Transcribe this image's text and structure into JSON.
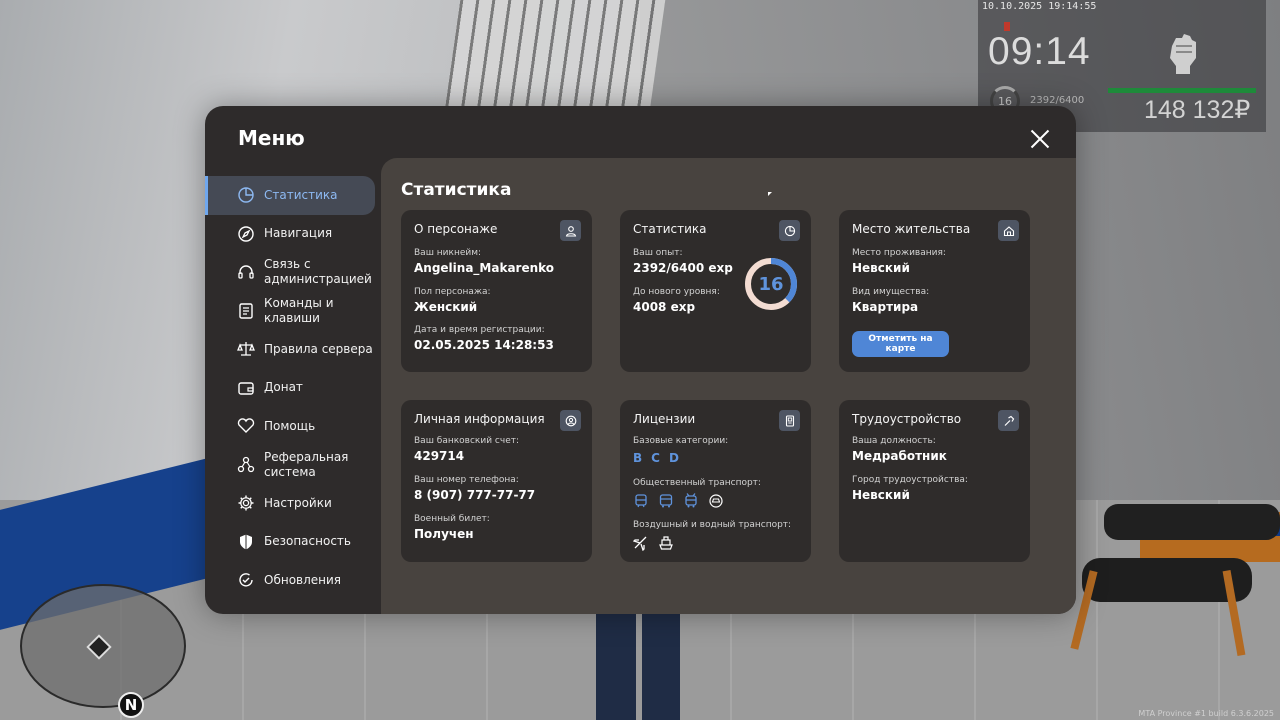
{
  "hud": {
    "datetime": "10.10.2025 19:14:55",
    "clock": "09:14",
    "level": "16",
    "exp": "2392/6400",
    "money": "148 132₽"
  },
  "minimap": {
    "north": "N"
  },
  "watermark": "MTA Province #1 build 6.3.6.2025",
  "menu": {
    "title": "Меню",
    "sidebar": [
      {
        "label": "Статистика",
        "icon": "pie-chart-icon"
      },
      {
        "label": "Навигация",
        "icon": "compass-icon"
      },
      {
        "label": "Связь с администрацией",
        "icon": "headset-icon"
      },
      {
        "label": "Команды и клавиши",
        "icon": "document-list-icon"
      },
      {
        "label": "Правила сервера",
        "icon": "scales-icon"
      },
      {
        "label": "Донат",
        "icon": "wallet-icon"
      },
      {
        "label": "Помощь",
        "icon": "handshake-heart-icon"
      },
      {
        "label": "Реферальная система",
        "icon": "network-icon"
      },
      {
        "label": "Настройки",
        "icon": "gear-icon"
      },
      {
        "label": "Безопасность",
        "icon": "shield-icon"
      },
      {
        "label": "Обновления",
        "icon": "refresh-check-icon"
      }
    ],
    "content_title": "Статистика",
    "cards": {
      "character": {
        "title": "О персонаже",
        "nickname_label": "Ваш никнейм:",
        "nickname": "Angelina_Makarenko",
        "gender_label": "Пол персонажа:",
        "gender": "Женский",
        "reg_label": "Дата и время регистрации:",
        "reg": "02.05.2025 14:28:53"
      },
      "stats": {
        "title": "Статистика",
        "exp_label": "Ваш опыт:",
        "exp": "2392/6400 exp",
        "next_label": "До нового уровня:",
        "next": "4008 exp",
        "level": "16",
        "progress": 0.374
      },
      "residence": {
        "title": "Место жительства",
        "place_label": "Место проживания:",
        "place": "Невский",
        "property_label": "Вид имущества:",
        "property": "Квартира",
        "button": "Отметить на карте"
      },
      "personal": {
        "title": "Личная информация",
        "bank_label": "Ваш банковский счет:",
        "bank": "429714",
        "phone_label": "Ваш номер телефона:",
        "phone": "8 (907) 777-77-77",
        "military_label": "Военный билет:",
        "military": "Получен"
      },
      "licenses": {
        "title": "Лицензии",
        "basic_label": "Базовые категории:",
        "categories": [
          "B",
          "C",
          "D"
        ],
        "public_label": "Общественный транспорт:",
        "air_label": "Воздушный и водный транспорт:"
      },
      "employment": {
        "title": "Трудоустройство",
        "position_label": "Ваша должность:",
        "position": "Медработник",
        "city_label": "Город трудоустройства:",
        "city": "Невский"
      }
    }
  }
}
